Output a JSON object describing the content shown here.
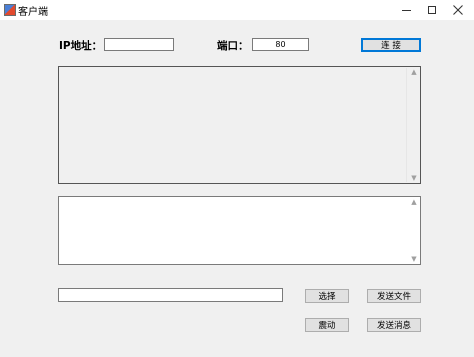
{
  "window": {
    "title": "客户端",
    "icon": "app-icon",
    "controls": [
      "minimize-icon",
      "maximize-icon",
      "close-icon"
    ]
  },
  "connection": {
    "ip_label": "IP地址：",
    "ip_value": "",
    "port_label": "端口：",
    "port_value": "80",
    "connect_label": "连  接"
  },
  "received_log": {
    "text": ""
  },
  "message_input": {
    "text": ""
  },
  "file": {
    "path_value": "",
    "choose_label": "选择",
    "send_file_label": "发送文件"
  },
  "actions": {
    "shake_label": "震动",
    "send_message_label": "发送消息"
  },
  "scroll_arrows": {
    "up": "▲",
    "down": "▼"
  },
  "colors": {
    "window_bg": "#f0f0f0",
    "button_bg": "#e1e1e1",
    "focus_border": "#0078d7"
  }
}
